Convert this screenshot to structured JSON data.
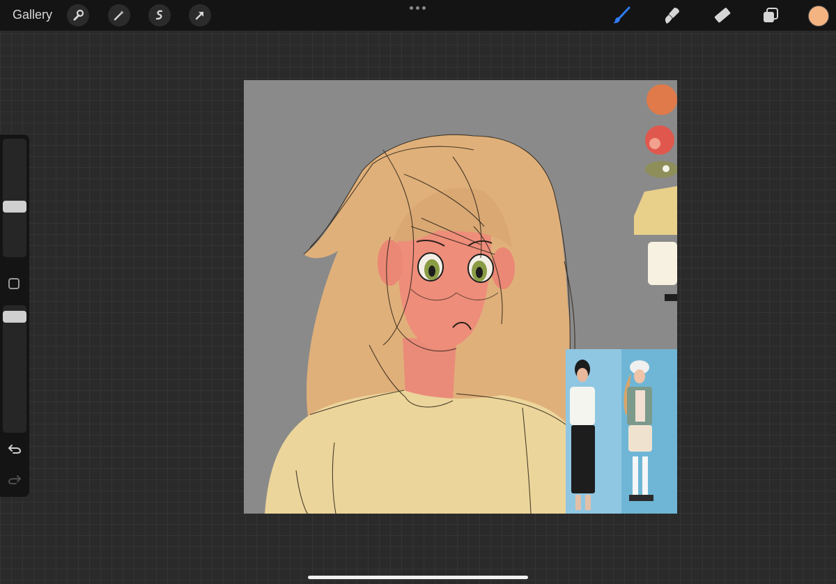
{
  "topbar": {
    "gallery_label": "Gallery",
    "left_tools": [
      "wrench-icon",
      "magic-wand-icon",
      "selection-icon",
      "transform-arrow-icon"
    ],
    "right_tools": [
      "brush-icon",
      "smudge-icon",
      "eraser-icon",
      "layers-icon"
    ],
    "active_tool": "brush-icon",
    "current_color": "#f4b482"
  },
  "sidebar": {
    "brush_size_level": 0.42,
    "opacity_level": 0.95,
    "controls": [
      "brush-size-slider",
      "modify-button",
      "opacity-slider",
      "undo-icon",
      "redo-icon"
    ]
  },
  "canvas": {
    "background_color": "#8a8a8a",
    "content": "artwork"
  },
  "colors": {
    "accent": "#2f7cf6",
    "hair": "#e0b07a",
    "skin": "#e98a78",
    "sweater": "#ecd59a"
  }
}
